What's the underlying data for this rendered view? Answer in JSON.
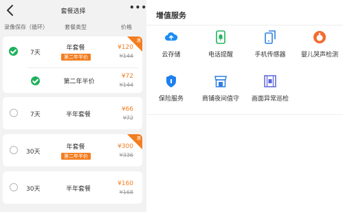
{
  "header": {
    "title": "套餐选择",
    "more": "•••"
  },
  "columns": {
    "storage": "录像保存（循环）",
    "type": "套餐类型",
    "price": "价格"
  },
  "plans": [
    {
      "days": "7天",
      "name": "年套餐",
      "badge": "第二年半价",
      "price": "¥120",
      "old_price": "¥144",
      "corner": "惠",
      "selected": true
    },
    {
      "days": "",
      "name": "第二年半价",
      "badge": "",
      "price": "¥72",
      "old_price": "¥144",
      "corner": "",
      "selected": true
    },
    {
      "days": "7天",
      "name": "半年套餐",
      "badge": "",
      "price": "¥66",
      "old_price": "¥72",
      "corner": "",
      "selected": false
    },
    {
      "days": "30天",
      "name": "年套餐",
      "badge": "第二年半价",
      "price": "¥300",
      "old_price": "¥336",
      "corner": "惠",
      "selected": false
    },
    {
      "days": "30天",
      "name": "半年套餐",
      "badge": "",
      "price": "¥160",
      "old_price": "¥168",
      "corner": "",
      "selected": false
    }
  ],
  "services": {
    "title": "增值服务",
    "items": [
      {
        "label": "云存储",
        "icon": "cloud-upload-icon",
        "color": "#1e8cf0"
      },
      {
        "label": "电话提醒",
        "icon": "phone-alert-icon",
        "color": "#22b35e"
      },
      {
        "label": "手机传感器",
        "icon": "phone-sensor-icon",
        "color": "#2f7fe0"
      },
      {
        "label": "婴儿哭声检测",
        "icon": "baby-cry-icon",
        "color": "#f26b2e"
      },
      {
        "label": "保险服务",
        "icon": "shield-icon",
        "color": "#1e7ff0"
      },
      {
        "label": "商铺夜间值守",
        "icon": "shop-icon",
        "color": "#2f7fe0"
      },
      {
        "label": "画面异常巡检",
        "icon": "film-icon",
        "color": "#5a63d8"
      }
    ]
  }
}
